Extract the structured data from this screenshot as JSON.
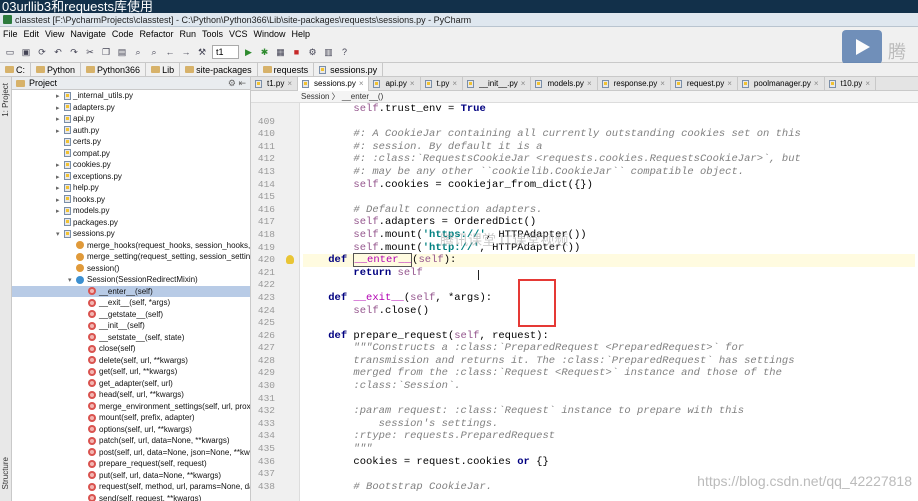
{
  "video_title": "03urllib3和requests库使用",
  "window_title": "classtest [F:\\PycharmProjects\\classtest] - C:\\Python\\Python366\\Lib\\site-packages\\requests\\sessions.py - PyCharm",
  "menu": [
    "File",
    "Edit",
    "View",
    "Navigate",
    "Code",
    "Refactor",
    "Run",
    "Tools",
    "VCS",
    "Window",
    "Help"
  ],
  "run_config": "t1",
  "logo_text": "腾",
  "nav_crumbs": [
    "C:",
    "Python",
    "Python366",
    "Lib",
    "site-packages",
    "requests",
    "sessions.py"
  ],
  "side_tabs": {
    "project": "1: Project",
    "structure": "Structure"
  },
  "project_header": "Project",
  "tree": [
    {
      "kind": "file",
      "label": "_internal_utils.py",
      "indent": 3,
      "arrow": "▸"
    },
    {
      "kind": "file",
      "label": "adapters.py",
      "indent": 3,
      "arrow": "▸"
    },
    {
      "kind": "file",
      "label": "api.py",
      "indent": 3,
      "arrow": "▸"
    },
    {
      "kind": "file",
      "label": "auth.py",
      "indent": 3,
      "arrow": "▸"
    },
    {
      "kind": "file",
      "label": "certs.py",
      "indent": 3,
      "arrow": ""
    },
    {
      "kind": "file",
      "label": "compat.py",
      "indent": 3,
      "arrow": ""
    },
    {
      "kind": "file",
      "label": "cookies.py",
      "indent": 3,
      "arrow": "▸"
    },
    {
      "kind": "file",
      "label": "exceptions.py",
      "indent": 3,
      "arrow": "▸"
    },
    {
      "kind": "file",
      "label": "help.py",
      "indent": 3,
      "arrow": "▸"
    },
    {
      "kind": "file",
      "label": "hooks.py",
      "indent": 3,
      "arrow": "▸"
    },
    {
      "kind": "file",
      "label": "models.py",
      "indent": 3,
      "arrow": "▸"
    },
    {
      "kind": "file",
      "label": "packages.py",
      "indent": 3,
      "arrow": ""
    },
    {
      "kind": "file",
      "label": "sessions.py",
      "indent": 3,
      "arrow": "▾"
    },
    {
      "kind": "func",
      "label": "merge_hooks(request_hooks, session_hooks, dict_cl",
      "indent": 4,
      "arrow": ""
    },
    {
      "kind": "func",
      "label": "merge_setting(request_setting, session_setting, dict",
      "indent": 4,
      "arrow": ""
    },
    {
      "kind": "func",
      "label": "session()",
      "indent": 4,
      "arrow": ""
    },
    {
      "kind": "class",
      "label": "Session(SessionRedirectMixin)",
      "indent": 4,
      "arrow": "▾"
    },
    {
      "kind": "method",
      "label": "__enter__(self)",
      "indent": 5,
      "arrow": "",
      "selected": true
    },
    {
      "kind": "method",
      "label": "__exit__(self, *args)",
      "indent": 5,
      "arrow": ""
    },
    {
      "kind": "method",
      "label": "__getstate__(self)",
      "indent": 5,
      "arrow": ""
    },
    {
      "kind": "method",
      "label": "__init__(self)",
      "indent": 5,
      "arrow": ""
    },
    {
      "kind": "method",
      "label": "__setstate__(self, state)",
      "indent": 5,
      "arrow": ""
    },
    {
      "kind": "method",
      "label": "close(self)",
      "indent": 5,
      "arrow": ""
    },
    {
      "kind": "method",
      "label": "delete(self, url, **kwargs)",
      "indent": 5,
      "arrow": ""
    },
    {
      "kind": "method",
      "label": "get(self, url, **kwargs)",
      "indent": 5,
      "arrow": ""
    },
    {
      "kind": "method",
      "label": "get_adapter(self, url)",
      "indent": 5,
      "arrow": ""
    },
    {
      "kind": "method",
      "label": "head(self, url, **kwargs)",
      "indent": 5,
      "arrow": ""
    },
    {
      "kind": "method",
      "label": "merge_environment_settings(self, url, proxies, str",
      "indent": 5,
      "arrow": ""
    },
    {
      "kind": "method",
      "label": "mount(self, prefix, adapter)",
      "indent": 5,
      "arrow": ""
    },
    {
      "kind": "method",
      "label": "options(self, url, **kwargs)",
      "indent": 5,
      "arrow": ""
    },
    {
      "kind": "method",
      "label": "patch(self, url, data=None, **kwargs)",
      "indent": 5,
      "arrow": ""
    },
    {
      "kind": "method",
      "label": "post(self, url, data=None, json=None, **kwargs)",
      "indent": 5,
      "arrow": ""
    },
    {
      "kind": "method",
      "label": "prepare_request(self, request)",
      "indent": 5,
      "arrow": ""
    },
    {
      "kind": "method",
      "label": "put(self, url, data=None, **kwargs)",
      "indent": 5,
      "arrow": ""
    },
    {
      "kind": "method",
      "label": "request(self, method, url, params=None, data=",
      "indent": 5,
      "arrow": ""
    },
    {
      "kind": "method",
      "label": "send(self, request, **kwargs)",
      "indent": 5,
      "arrow": ""
    }
  ],
  "editor_tabs": [
    {
      "label": "t1.py",
      "active": false
    },
    {
      "label": "sessions.py",
      "active": true
    },
    {
      "label": "api.py",
      "active": false
    },
    {
      "label": "t.py",
      "active": false
    },
    {
      "label": "__init__.py",
      "active": false
    },
    {
      "label": "models.py",
      "active": false
    },
    {
      "label": "response.py",
      "active": false
    },
    {
      "label": "request.py",
      "active": false
    },
    {
      "label": "poolmanager.py",
      "active": false
    },
    {
      "label": "t10.py",
      "active": false
    }
  ],
  "code_breadcrumb": "Session  〉 __enter__()",
  "code_lines": [
    {
      "n": "",
      "html": "        <span class=\"self\">self</span>.trust_env = <span class=\"kw\">True</span>"
    },
    {
      "n": "409",
      "html": ""
    },
    {
      "n": "410",
      "html": "        <span class=\"cm\">#: A CookieJar containing all currently outstanding cookies set on this</span>"
    },
    {
      "n": "411",
      "html": "        <span class=\"cm\">#: session. By default it is a</span>"
    },
    {
      "n": "412",
      "html": "        <span class=\"cm\">#: :class:`RequestsCookieJar &lt;requests.cookies.RequestsCookieJar&gt;`, but</span>"
    },
    {
      "n": "413",
      "html": "        <span class=\"cm\">#: may be any other ``cookielib.CookieJar`` compatible object.</span>"
    },
    {
      "n": "414",
      "html": "        <span class=\"self\">self</span>.cookies = cookiejar_from_dict({})"
    },
    {
      "n": "415",
      "html": ""
    },
    {
      "n": "416",
      "html": "        <span class=\"cm\"># Default connection adapters.</span>"
    },
    {
      "n": "417",
      "html": "        <span class=\"self\">self</span>.adapters = OrderedDict()"
    },
    {
      "n": "418",
      "html": "        <span class=\"self\">self</span>.mount(<span class=\"st\">'https://'</span>, HTTPAdapter())"
    },
    {
      "n": "419",
      "html": "        <span class=\"self\">self</span>.mount(<span class=\"st\">'http://'</span>, HTTPAdapter())"
    },
    {
      "n": "420",
      "html": "    <span class=\"kw\">def</span> <span class=\"sel\"><span class=\"dunder\">__enter__</span></span>(<span class=\"self\">self</span>):",
      "caret": true,
      "bulb": true
    },
    {
      "n": "421",
      "html": "        <span class=\"kw\">return</span> <span class=\"self\">self</span>"
    },
    {
      "n": "422",
      "html": ""
    },
    {
      "n": "423",
      "html": "    <span class=\"kw\">def</span> <span class=\"dunder\">__exit__</span>(<span class=\"self\">self</span>, *args):"
    },
    {
      "n": "424",
      "html": "        <span class=\"self\">self</span>.close()"
    },
    {
      "n": "425",
      "html": ""
    },
    {
      "n": "426",
      "html": "    <span class=\"kw\">def</span> prepare_request(<span class=\"self\">self</span>, request):"
    },
    {
      "n": "427",
      "html": "        <span class=\"doc\">\"\"\"Constructs a :class:`PreparedRequest &lt;PreparedRequest&gt;` for</span>"
    },
    {
      "n": "428",
      "html": "        <span class=\"doc\">transmission and returns it. The :class:`PreparedRequest` has settings</span>"
    },
    {
      "n": "429",
      "html": "        <span class=\"doc\">merged from the :class:`Request &lt;Request&gt;` instance and those of the</span>"
    },
    {
      "n": "430",
      "html": "        <span class=\"doc\">:class:`Session`.</span>"
    },
    {
      "n": "431",
      "html": ""
    },
    {
      "n": "432",
      "html": "        <span class=\"doc\">:param request: :class:`Request` instance to prepare with this</span>"
    },
    {
      "n": "433",
      "html": "        <span class=\"doc\">    session's settings.</span>"
    },
    {
      "n": "434",
      "html": "        <span class=\"doc\">:rtype: requests.PreparedRequest</span>"
    },
    {
      "n": "435",
      "html": "        <span class=\"doc\">\"\"\"</span>"
    },
    {
      "n": "436",
      "html": "        cookies = request.cookies <span class=\"kw\">or</span> {}"
    },
    {
      "n": "437",
      "html": ""
    },
    {
      "n": "438",
      "html": "        <span class=\"cm\"># Bootstrap CookieJar.</span>"
    }
  ],
  "watermark": "腾讯课堂 IT课堂视频",
  "csdn_watermark": "https://blog.csdn.net/qq_42227818"
}
